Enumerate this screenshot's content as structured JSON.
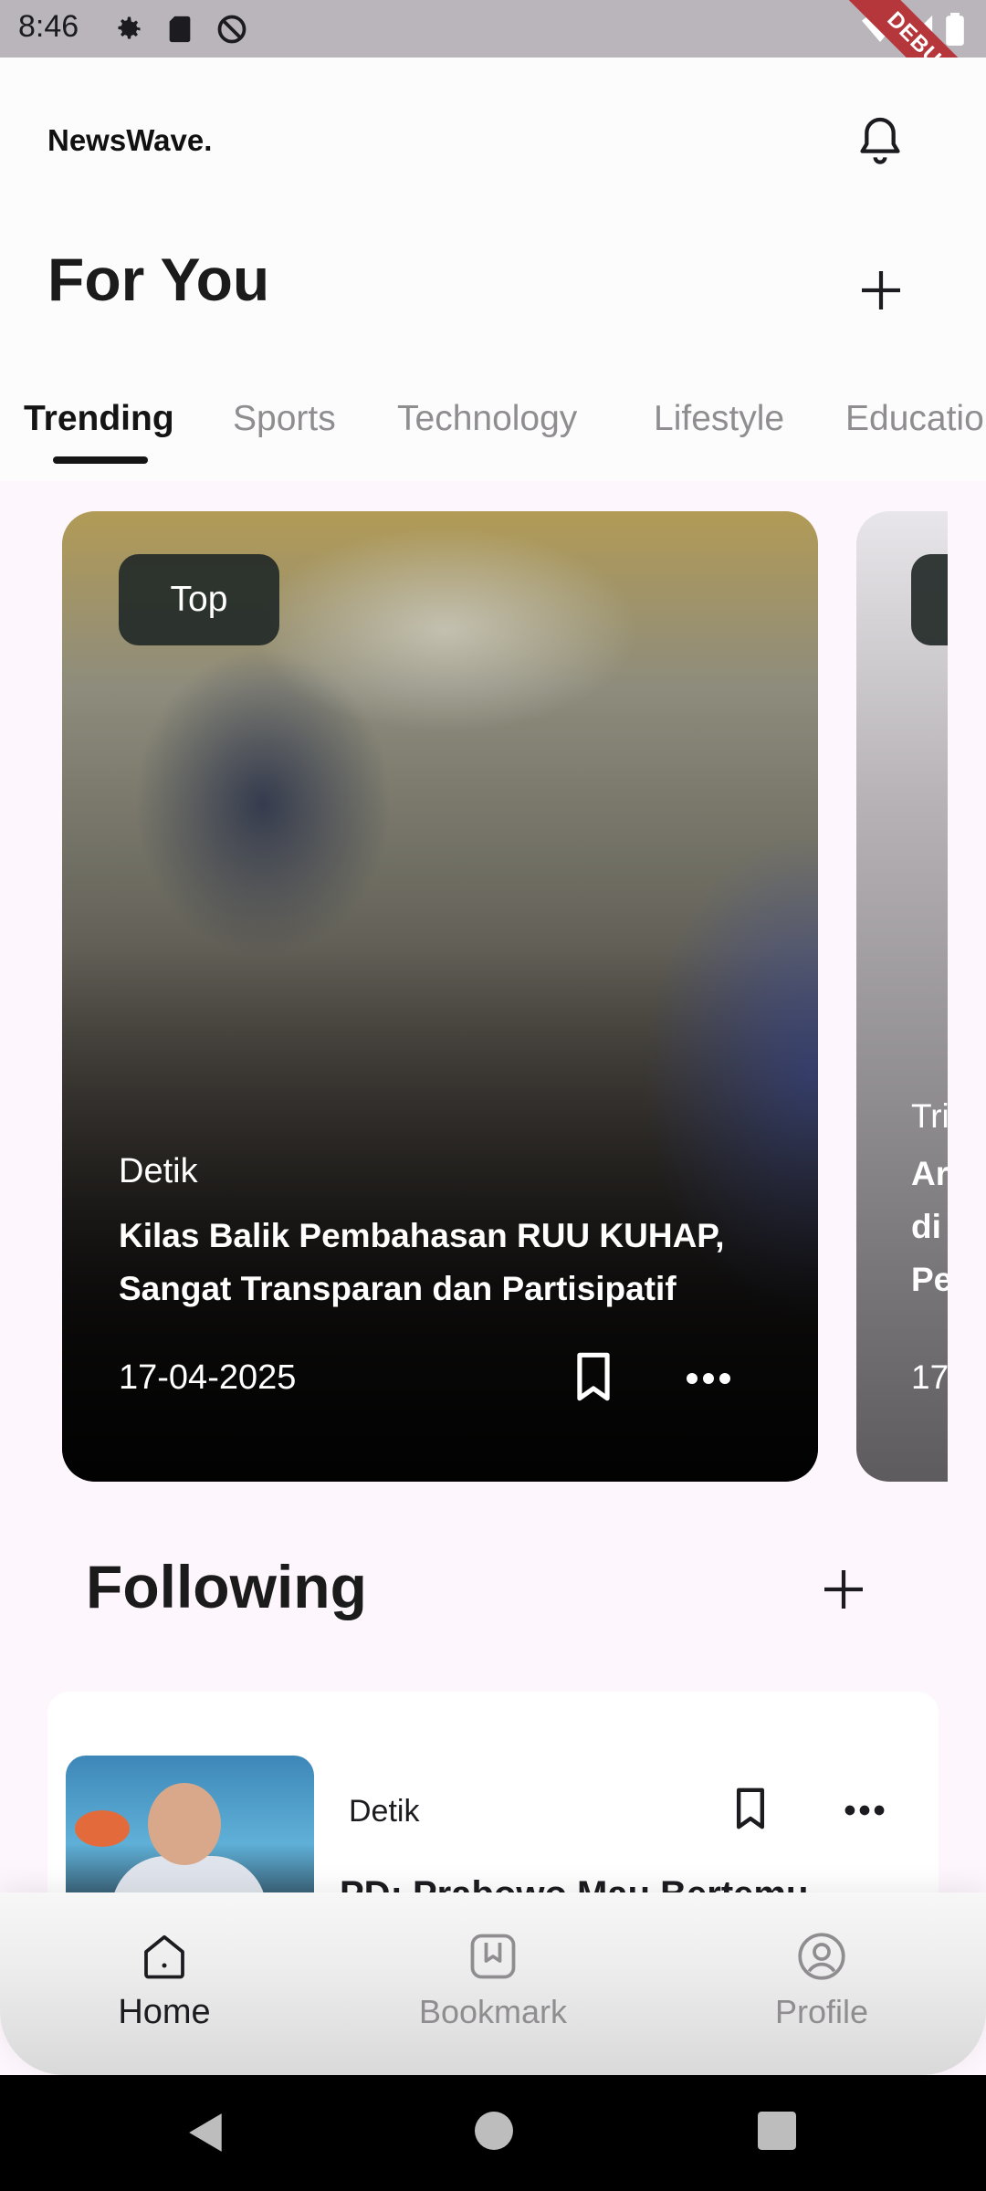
{
  "status_bar": {
    "time": "8:46",
    "debug_label": "DEBUG",
    "icons": [
      "gear-icon",
      "sd-card-icon",
      "no-sync-icon",
      "wifi-icon",
      "signal-icon",
      "battery-icon"
    ]
  },
  "header": {
    "brand": "NewsWave.",
    "title": "For You",
    "icons": [
      "bell-icon",
      "plus-icon"
    ]
  },
  "tabs": [
    {
      "label": "Trending",
      "active": true
    },
    {
      "label": "Sports",
      "active": false
    },
    {
      "label": "Technology",
      "active": false
    },
    {
      "label": "Lifestyle",
      "active": false
    },
    {
      "label": "Education",
      "active": false
    }
  ],
  "featured": {
    "badge": "Top",
    "source": "Detik",
    "title": "Kilas Balik Pembahasan RUU KUHAP, Sangat Transparan dan Partisipatif",
    "date": "17-04-2025"
  },
  "featured_peek": {
    "source": "Tri",
    "title_lines": [
      "Ar",
      "di",
      "Pe"
    ],
    "date": "17-"
  },
  "following": {
    "title": "Following",
    "items": [
      {
        "source": "Detik",
        "title": "PD: Prabowo Mau Bertemu"
      }
    ]
  },
  "bottom_nav": [
    {
      "label": "Home",
      "icon": "home-icon",
      "active": true
    },
    {
      "label": "Bookmark",
      "icon": "bookmark-icon",
      "active": false
    },
    {
      "label": "Profile",
      "icon": "profile-icon",
      "active": false
    }
  ],
  "colors": {
    "background": "#fdf6fd",
    "header_bg": "#fcfcfc",
    "inactive_text": "#8f8d90",
    "debug_banner": "#b5363b"
  }
}
